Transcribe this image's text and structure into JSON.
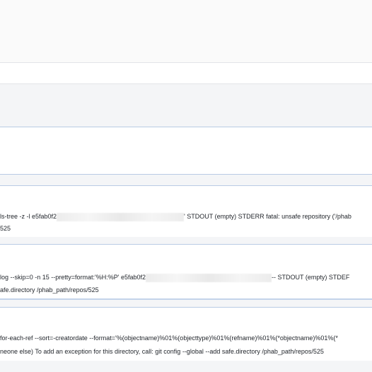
{
  "errors": [
    {
      "line1_a": "ls-tree -z -l e5fab0f2",
      "line1_b": "' STDOUT (empty) STDERR fatal: unsafe repository ('/phab",
      "line2": "525"
    },
    {
      "line1_a": "log --skip=0 -n 15 --pretty=format:'%H:%P' e5fab0f2",
      "line1_b": "-- STDOUT (empty) STDEF",
      "line2": "afe.directory /phab_path/repos/525"
    },
    {
      "line1": "for-each-ref --sort=-creatordate --format='%(objectname)%01%(objecttype)%01%(refname)%01%(*objectname)%01%(*",
      "line2": "neone else) To add an exception for this directory, call: git config --global --add safe.directory /phab_path/repos/525"
    }
  ]
}
